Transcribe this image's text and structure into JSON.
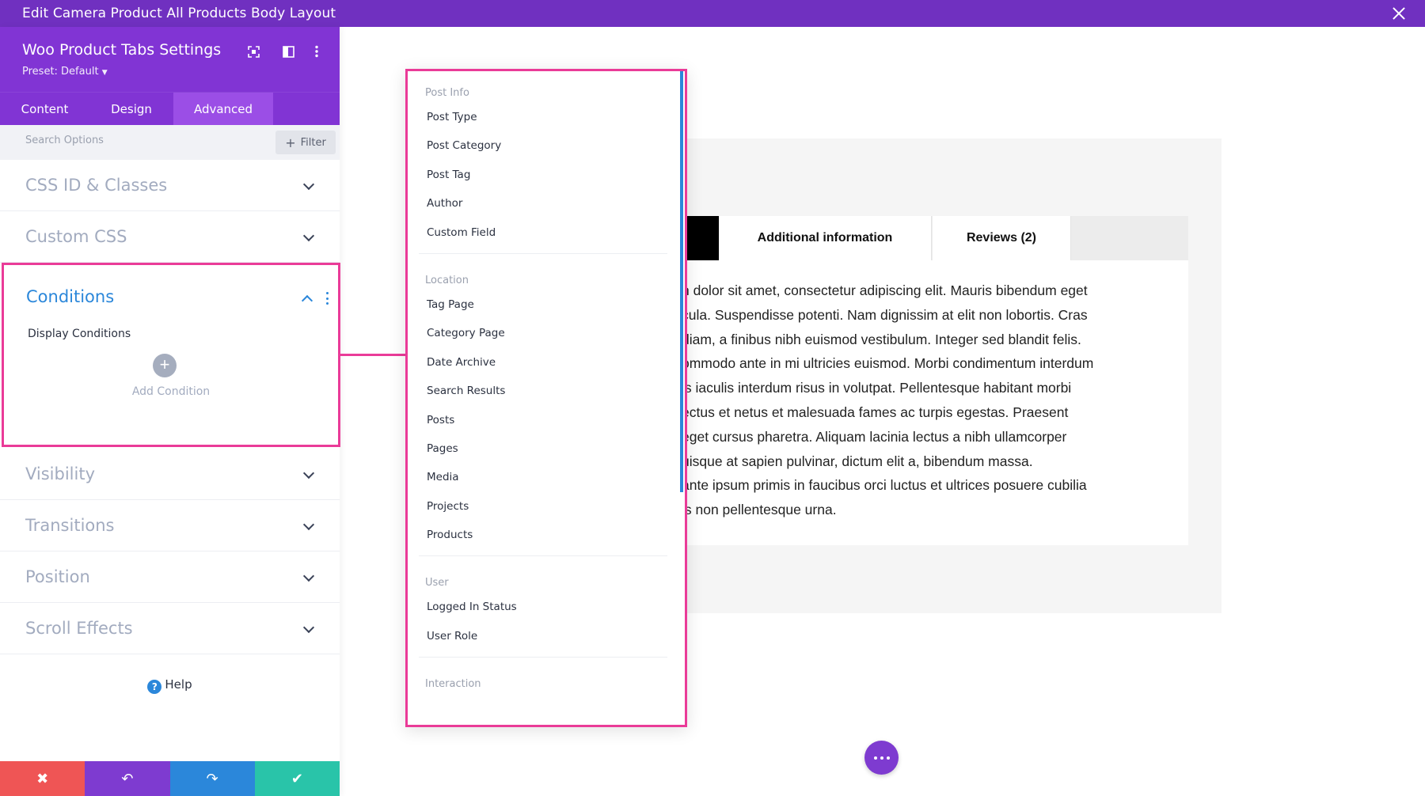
{
  "window": {
    "title": "Edit Camera Product All Products Body Layout"
  },
  "panel": {
    "title": "Woo Product Tabs Settings",
    "preset": "Preset: Default",
    "tabs": [
      {
        "label": "Content"
      },
      {
        "label": "Design"
      },
      {
        "label": "Advanced"
      }
    ],
    "search": {
      "placeholder": "Search Options"
    },
    "filter_label": "Filter",
    "sections": {
      "css_id": "CSS ID & Classes",
      "custom_css": "Custom CSS",
      "visibility": "Visibility",
      "transitions": "Transitions",
      "position": "Position",
      "scroll_effects": "Scroll Effects"
    },
    "conditions": {
      "title": "Conditions",
      "display_label": "Display Conditions",
      "add_label": "Add Condition"
    },
    "help_label": "Help",
    "actions": {
      "discard_icon": "✖",
      "undo_icon": "↶",
      "redo_icon": "↷",
      "save_icon": "✔"
    },
    "action_colors": [
      "#ef5555",
      "#7e3bd0",
      "#2b87da",
      "#29c4a9"
    ]
  },
  "product_tabs": {
    "tab_additional": "Additional information",
    "tab_reviews": "Reviews (2)",
    "content_lines": [
      "n dolor sit amet, consectetur adipiscing elit. Mauris bibendum eget",
      "cula. Suspendisse potenti. Nam dignissim at elit non lobortis. Cras",
      "diam, a finibus nibh euismod vestibulum. Integer sed blandit felis.",
      "ommodo ante in mi ultricies euismod. Morbi condimentum interdum",
      "is iaculis interdum risus in volutpat. Pellentesque habitant morbi",
      "ectus et netus et malesuada fames ac turpis egestas. Praesent",
      "eget cursus pharetra. Aliquam lacinia lectus a nibh ullamcorper",
      "uisque at sapien pulvinar, dictum elit a, bibendum massa.",
      "ante ipsum primis in faucibus orci luctus et ultrices posuere cubilia",
      "is non pellentesque urna."
    ]
  },
  "dropdown": {
    "groups": [
      {
        "heading": "Post Info",
        "items": [
          "Post Type",
          "Post Category",
          "Post Tag",
          "Author",
          "Custom Field"
        ]
      },
      {
        "heading": "Location",
        "items": [
          "Tag Page",
          "Category Page",
          "Date Archive",
          "Search Results",
          "Posts",
          "Pages",
          "Media",
          "Projects",
          "Products"
        ]
      },
      {
        "heading": "User",
        "items": [
          "Logged In Status",
          "User Role"
        ]
      },
      {
        "heading": "Interaction",
        "items": []
      }
    ]
  },
  "colors": {
    "titlebar": "#7030c0",
    "panel_header": "#8134d4",
    "highlight": "#ea3b98",
    "accent_blue": "#2b87da"
  }
}
